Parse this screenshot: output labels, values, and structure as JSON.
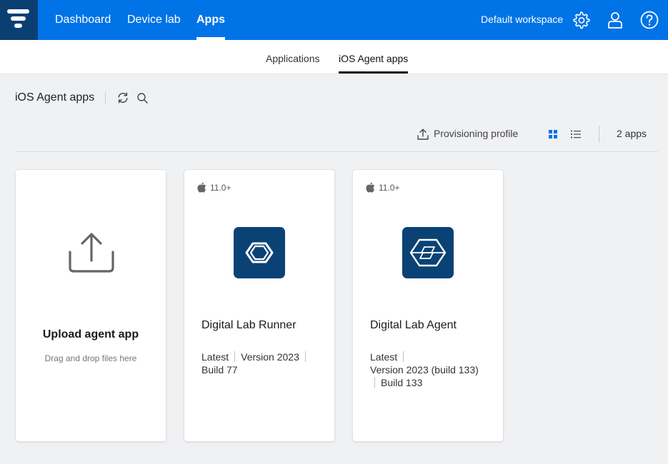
{
  "topnav": {
    "items": [
      {
        "label": "Dashboard",
        "active": false
      },
      {
        "label": "Device lab",
        "active": false
      },
      {
        "label": "Apps",
        "active": true
      }
    ],
    "workspace": "Default workspace",
    "icons": [
      "gear-icon",
      "user-icon",
      "help-icon"
    ]
  },
  "subtabs": [
    {
      "label": "Applications",
      "active": false
    },
    {
      "label": "iOS Agent apps",
      "active": true
    }
  ],
  "header": {
    "title": "iOS Agent apps",
    "icons": [
      "refresh-icon",
      "search-icon"
    ]
  },
  "toolbar": {
    "provisioning_label": "Provisioning profile",
    "view_modes": [
      "grid",
      "list"
    ],
    "active_view": "grid",
    "count_label": "2 apps"
  },
  "upload_card": {
    "title": "Upload agent app",
    "subtitle": "Drag and drop files here"
  },
  "apps": [
    {
      "os": "11.0+",
      "name": "Digital Lab Runner",
      "meta_line1": [
        "Latest",
        "Version 2023"
      ],
      "meta_line2": "Build 77"
    },
    {
      "os": "11.0+",
      "name": "Digital Lab Agent",
      "meta_line1": "Latest",
      "meta_line2": "Version 2023 (build 133)",
      "meta_line3": "Build 133"
    }
  ],
  "colors": {
    "topbar": "#0073e7",
    "logo_bg": "#0a3f72",
    "app_icon_bg": "#0a4275",
    "grid_active": "#0073e7"
  }
}
